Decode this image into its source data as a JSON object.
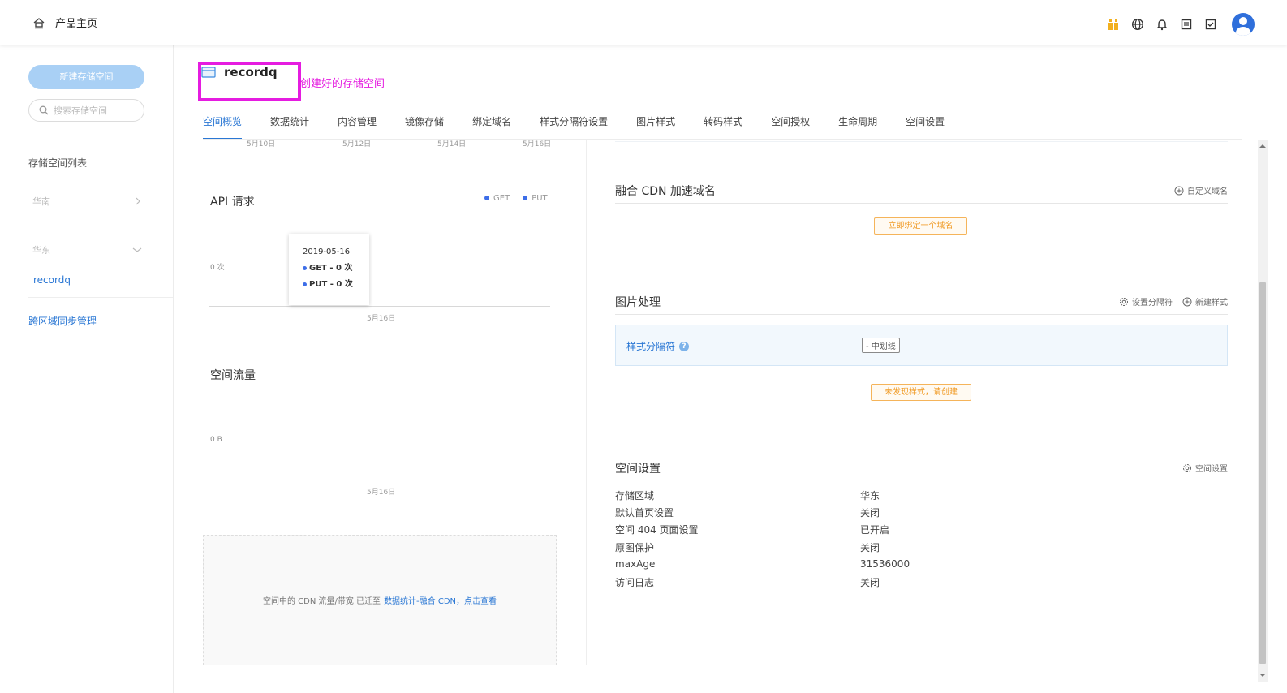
{
  "topbar": {
    "home_label": "产品主页",
    "icons": [
      "gift-icon",
      "globe-icon",
      "bell-icon",
      "document-icon",
      "checklist-icon",
      "avatar"
    ]
  },
  "sidebar": {
    "new_bucket_button": "新建存储空间",
    "search_placeholder": "搜索存储空间",
    "list_title": "存储空间列表",
    "regions": [
      {
        "label": "华南",
        "expanded": false
      },
      {
        "label": "华东",
        "expanded": true
      }
    ],
    "buckets": [
      "recordq"
    ],
    "sync_link": "跨区域同步管理"
  },
  "header": {
    "bucket_name": "recordq",
    "annotation": "创建好的存储空间"
  },
  "tabs": [
    {
      "label": "空间概览",
      "active": true
    },
    {
      "label": "数据统计",
      "active": false
    },
    {
      "label": "内容管理",
      "active": false
    },
    {
      "label": "镜像存储",
      "active": false
    },
    {
      "label": "绑定域名",
      "active": false
    },
    {
      "label": "样式分隔符设置",
      "active": false
    },
    {
      "label": "图片样式",
      "active": false
    },
    {
      "label": "转码样式",
      "active": false
    },
    {
      "label": "空间授权",
      "active": false
    },
    {
      "label": "生命周期",
      "active": false
    },
    {
      "label": "空间设置",
      "active": false
    }
  ],
  "overview": {
    "top_axis_dates": [
      "5月10日",
      "5月12日",
      "5月14日",
      "5月16日"
    ],
    "api_chart": {
      "title": "API 请求",
      "legend": [
        "GET",
        "PUT"
      ],
      "y_label": "0 次",
      "x_label": "5月16日",
      "tooltip": {
        "date": "2019-05-16",
        "get_line": "GET - 0 次",
        "put_line": "PUT - 0 次"
      }
    },
    "traffic_chart": {
      "title": "空间流量",
      "y_label": "0 B",
      "x_label": "5月16日"
    },
    "cdn_notice": {
      "text": "空间中的 CDN 流量/带宽 已迁至",
      "link": "数据统计-融合 CDN，点击查看"
    }
  },
  "chart_data": [
    {
      "type": "line",
      "title": "API 请求",
      "x": [
        "2019-05-16"
      ],
      "series": [
        {
          "name": "GET",
          "values": [
            0
          ]
        },
        {
          "name": "PUT",
          "values": [
            0
          ]
        }
      ],
      "xlabel": "",
      "ylabel": ""
    },
    {
      "type": "line",
      "title": "空间流量",
      "x": [
        "2019-05-16"
      ],
      "series": [
        {
          "values": [
            0
          ]
        }
      ],
      "xlabel": "",
      "ylabel": ""
    }
  ],
  "cdn_section": {
    "title": "融合 CDN 加速域名",
    "action": "自定义域名",
    "bind_button": "立即绑定一个域名"
  },
  "image_section": {
    "title": "图片处理",
    "action_separator": "设置分隔符",
    "action_new_style": "新建样式",
    "separator_label": "样式分隔符",
    "separator_value": "- 中划线",
    "empty_button": "未发现样式，请创建"
  },
  "space_settings": {
    "title": "空间设置",
    "action": "空间设置",
    "rows": [
      {
        "key": "存储区域",
        "value": "华东"
      },
      {
        "key": "默认首页设置",
        "value": "关闭"
      },
      {
        "key": "空间 404 页面设置",
        "value": "已开启"
      },
      {
        "key": "原图保护",
        "value": "关闭"
      },
      {
        "key": "maxAge",
        "value": "31536000"
      },
      {
        "key": "访问日志",
        "value": "关闭"
      }
    ]
  },
  "colors": {
    "accent": "#2a77d4",
    "annotation": "#e51ce0",
    "warning": "#f09a24",
    "series": "#3d6ee8"
  }
}
